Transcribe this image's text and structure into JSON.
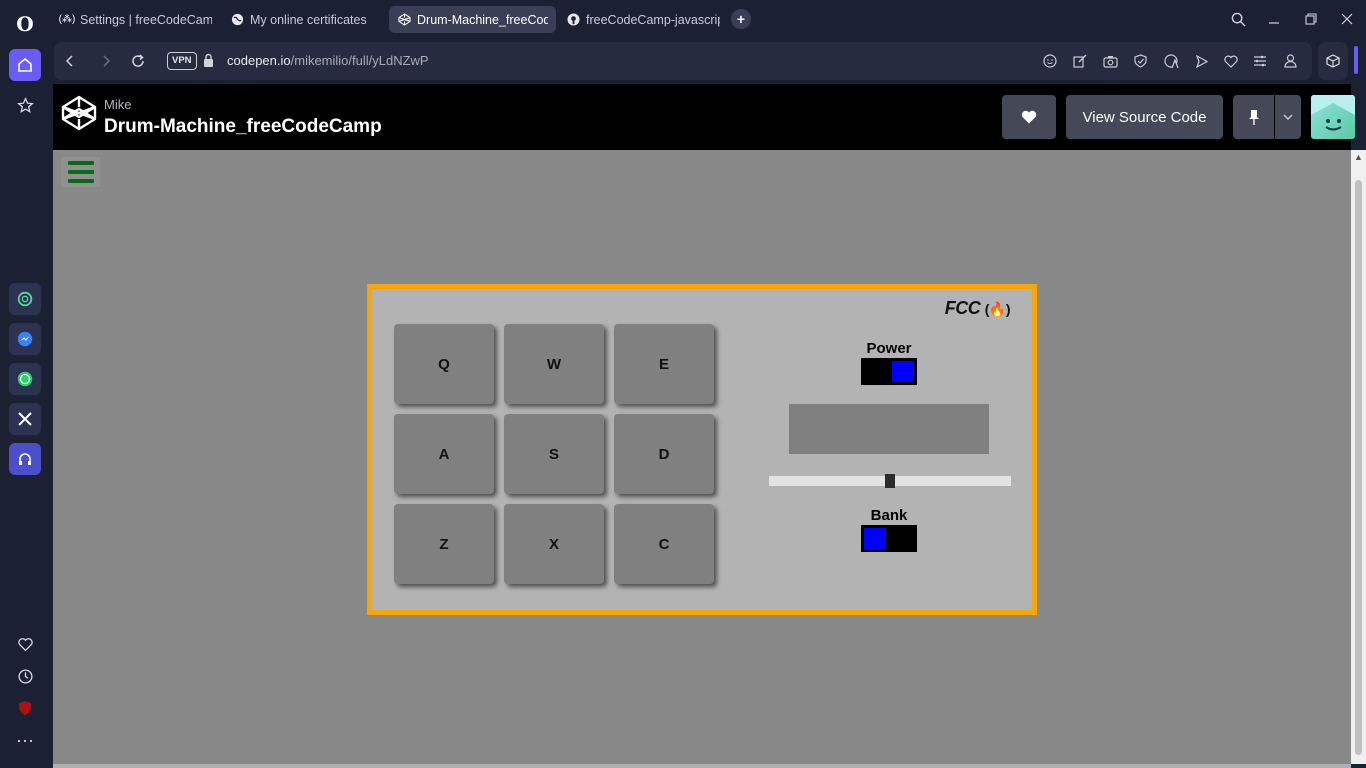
{
  "browser": {
    "tabs": [
      {
        "label": "Settings | freeCodeCamp.org",
        "icon": "fcc-icon"
      },
      {
        "label": "My online certificates",
        "icon": "globe-icon"
      },
      {
        "label": "Drum-Machine_freeCodeCamp",
        "icon": "codepen-icon",
        "active": true
      },
      {
        "label": "freeCodeCamp-javascript/",
        "icon": "github-icon"
      }
    ],
    "new_tab": "+",
    "address": {
      "vpn": "VPN",
      "host": "codepen.io",
      "path": "/mikemilio/full/yLdNZwP"
    }
  },
  "codepen": {
    "author": "Mike",
    "title": "Drum-Machine_freeCodeCamp",
    "view_source": "View Source Code"
  },
  "drum_machine": {
    "brand": "FCC",
    "brand_icon": "(🔥)",
    "pads": [
      "Q",
      "W",
      "E",
      "A",
      "S",
      "D",
      "Z",
      "X",
      "C"
    ],
    "power_label": "Power",
    "power_on": true,
    "display_text": "",
    "volume": 0.5,
    "bank_label": "Bank",
    "bank_on": false
  },
  "colors": {
    "frame": "#f5a70a",
    "machine_bg": "#b3b3b3",
    "pad": "#808080",
    "toggle_knob": "#0000ff",
    "hamburger": "#0b6b14",
    "opera_accent": "#6a5cf6"
  }
}
